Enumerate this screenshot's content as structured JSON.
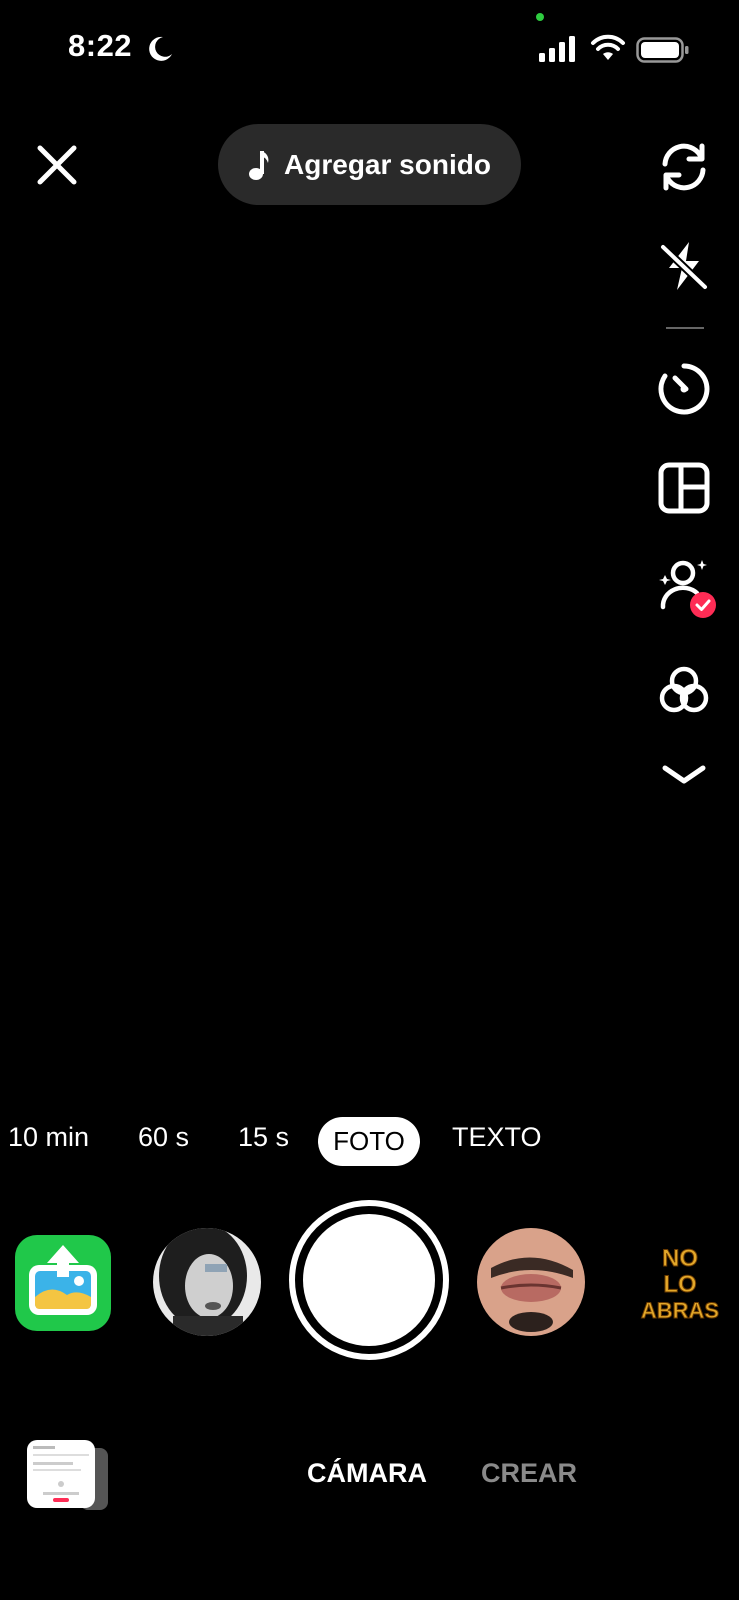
{
  "status_bar": {
    "time": "8:22"
  },
  "top_bar": {
    "add_sound_label": "Agregar sonido"
  },
  "right_rail": {
    "icons": [
      "flip-camera-icon",
      "flash-off-icon",
      "timer-icon",
      "layout-icon",
      "beauty-icon",
      "filters-icon",
      "chevron-down-icon"
    ]
  },
  "modes": {
    "items": [
      "10 min",
      "60 s",
      "15 s",
      "TEXTO"
    ],
    "active": "FOTO"
  },
  "effects_row": {
    "right_effect_text": "NO LO ABRAS"
  },
  "bottom_tabs": {
    "camera": "CÁMARA",
    "create": "CREAR"
  },
  "colors": {
    "accent": "#fe2c55",
    "upload_green": "#20c84a",
    "pill_bg": "#2a2a2a"
  }
}
